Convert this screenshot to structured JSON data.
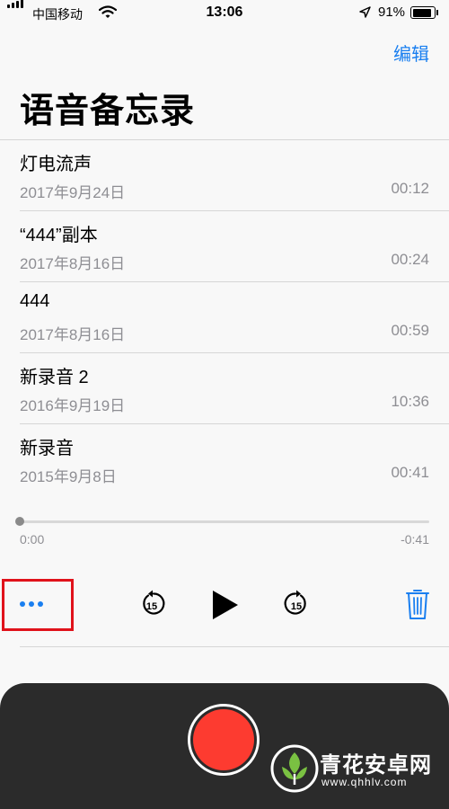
{
  "status_bar": {
    "carrier": "中国移动",
    "time": "13:06",
    "battery_percent": "91%",
    "battery_level": 0.91
  },
  "header": {
    "edit_label": "编辑",
    "title": "语音备忘录"
  },
  "memos": [
    {
      "name": "灯电流声",
      "date": "2017年9月24日",
      "duration": "00:12"
    },
    {
      "name": "“444”副本",
      "date": "2017年8月16日",
      "duration": "00:24"
    },
    {
      "name": "444",
      "date": "2017年8月16日",
      "duration": "00:59"
    },
    {
      "name": "新录音 2",
      "date": "2016年9月19日",
      "duration": "10:36"
    },
    {
      "name": "新录音",
      "date": "2015年9月8日",
      "duration": "00:41"
    }
  ],
  "player": {
    "elapsed": "0:00",
    "remaining": "-0:41",
    "progress": 0,
    "skip_seconds": "15"
  },
  "icons": {
    "more": "ellipsis-icon",
    "skip_back": "skip-back-15-icon",
    "play": "play-icon",
    "skip_forward": "skip-forward-15-icon",
    "trash": "trash-icon",
    "record": "record-icon"
  },
  "colors": {
    "accent": "#1a7ff0",
    "record": "#fd3b30",
    "highlight": "#e0121b",
    "panel": "#2b2b2b"
  },
  "watermark": {
    "title": "青花安卓网",
    "url": "www.qhhlv.com"
  }
}
